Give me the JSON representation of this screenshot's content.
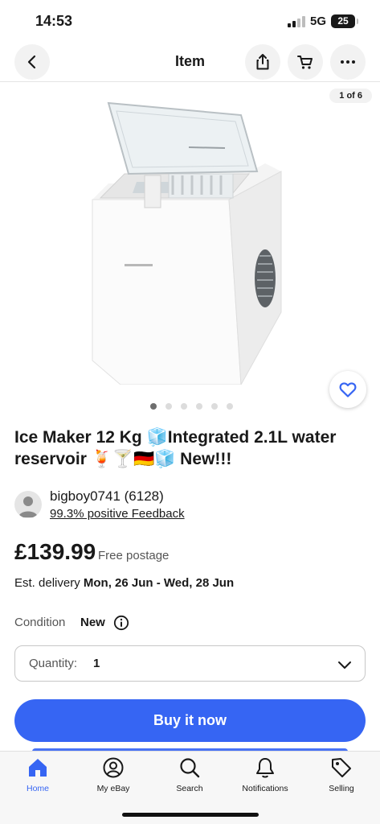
{
  "status_bar": {
    "time": "14:53",
    "network": "5G",
    "battery": "25"
  },
  "header": {
    "title": "Item",
    "back_icon": "chevron-left-icon",
    "share_icon": "share-icon",
    "cart_icon": "cart-icon",
    "more_icon": "more-icon"
  },
  "gallery": {
    "counter": "1 of 6",
    "total_images": 6,
    "active_index": 0
  },
  "listing": {
    "title": "Ice Maker 12 Kg 🧊Integrated 2.1L water reservoir 🍹🍸🇩🇪🧊 New!!!",
    "seller_name": "bigboy0741 (6128)",
    "seller_feedback": "99.3% positive Feedback",
    "price": "£139.99",
    "postage": "Free postage",
    "delivery_label": "Est. delivery",
    "delivery_dates": "Mon, 26 Jun - Wed, 28 Jun",
    "condition_label": "Condition",
    "condition_value": "New",
    "quantity_label": "Quantity:",
    "quantity_value": "1",
    "buy_label": "Buy it now"
  },
  "tabs": [
    {
      "label": "Home",
      "icon": "home-icon",
      "active": true
    },
    {
      "label": "My eBay",
      "icon": "user-icon",
      "active": false
    },
    {
      "label": "Search",
      "icon": "search-icon",
      "active": false
    },
    {
      "label": "Notifications",
      "icon": "bell-icon",
      "active": false
    },
    {
      "label": "Selling",
      "icon": "tag-icon",
      "active": false
    }
  ],
  "colors": {
    "accent": "#3665f3",
    "text": "#191919",
    "muted": "#555555"
  }
}
